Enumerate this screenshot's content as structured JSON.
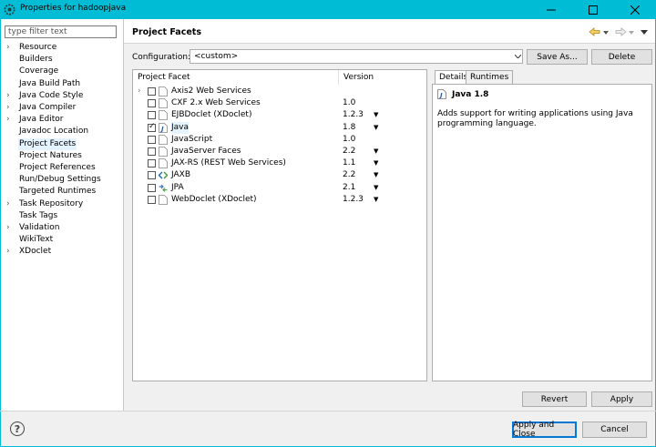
{
  "window": {
    "title": "Properties for hadoopjava"
  },
  "colors": {
    "titlebar": "#00bcd4",
    "selection": "#e5f3ff",
    "default_button_border": "#0078d7"
  },
  "filter": {
    "placeholder": "type filter text",
    "value": ""
  },
  "nav": {
    "items": [
      {
        "label": "Resource",
        "expandable": true
      },
      {
        "label": "Builders",
        "expandable": false
      },
      {
        "label": "Coverage",
        "expandable": false
      },
      {
        "label": "Java Build Path",
        "expandable": false
      },
      {
        "label": "Java Code Style",
        "expandable": true
      },
      {
        "label": "Java Compiler",
        "expandable": true
      },
      {
        "label": "Java Editor",
        "expandable": true
      },
      {
        "label": "Javadoc Location",
        "expandable": false
      },
      {
        "label": "Project Facets",
        "expandable": false,
        "selected": true
      },
      {
        "label": "Project Natures",
        "expandable": false
      },
      {
        "label": "Project References",
        "expandable": false
      },
      {
        "label": "Run/Debug Settings",
        "expandable": false
      },
      {
        "label": "Targeted Runtimes",
        "expandable": false
      },
      {
        "label": "Task Repository",
        "expandable": true
      },
      {
        "label": "Task Tags",
        "expandable": false
      },
      {
        "label": "Validation",
        "expandable": true
      },
      {
        "label": "WikiText",
        "expandable": false
      },
      {
        "label": "XDoclet",
        "expandable": true
      }
    ]
  },
  "page": {
    "title": "Project Facets"
  },
  "configuration": {
    "label": "Configuration:",
    "value": "<custom>",
    "save_as": "Save As...",
    "delete": "Delete"
  },
  "facets": {
    "col_facet": "Project Facet",
    "col_version": "Version",
    "rows": [
      {
        "name": "Axis2 Web Services",
        "version": "",
        "checked": false,
        "expandable": true,
        "dropdown": false,
        "icon": "page-icon"
      },
      {
        "name": "CXF 2.x Web Services",
        "version": "1.0",
        "checked": false,
        "expandable": false,
        "dropdown": false,
        "icon": "page-icon"
      },
      {
        "name": "EJBDoclet (XDoclet)",
        "version": "1.2.3",
        "checked": false,
        "expandable": false,
        "dropdown": true,
        "icon": "page-icon"
      },
      {
        "name": "Java",
        "version": "1.8",
        "checked": true,
        "expandable": false,
        "dropdown": true,
        "selected": true,
        "icon": "java-icon"
      },
      {
        "name": "JavaScript",
        "version": "1.0",
        "checked": false,
        "expandable": false,
        "dropdown": false,
        "icon": "page-icon"
      },
      {
        "name": "JavaServer Faces",
        "version": "2.2",
        "checked": false,
        "expandable": false,
        "dropdown": true,
        "icon": "page-icon"
      },
      {
        "name": "JAX-RS (REST Web Services)",
        "version": "1.1",
        "checked": false,
        "expandable": false,
        "dropdown": true,
        "icon": "page-icon"
      },
      {
        "name": "JAXB",
        "version": "2.2",
        "checked": false,
        "expandable": false,
        "dropdown": true,
        "icon": "jaxb-icon"
      },
      {
        "name": "JPA",
        "version": "2.1",
        "checked": false,
        "expandable": false,
        "dropdown": true,
        "icon": "jpa-icon"
      },
      {
        "name": "WebDoclet (XDoclet)",
        "version": "1.2.3",
        "checked": false,
        "expandable": false,
        "dropdown": true,
        "icon": "page-icon"
      }
    ]
  },
  "details": {
    "tab_details": "Details",
    "tab_runtimes": "Runtimes",
    "title": "Java 1.8",
    "description": "Adds support for writing applications using Java programming language."
  },
  "buttons": {
    "revert": "Revert",
    "apply": "Apply",
    "apply_close": "Apply and Close",
    "cancel": "Cancel",
    "help": "?"
  }
}
